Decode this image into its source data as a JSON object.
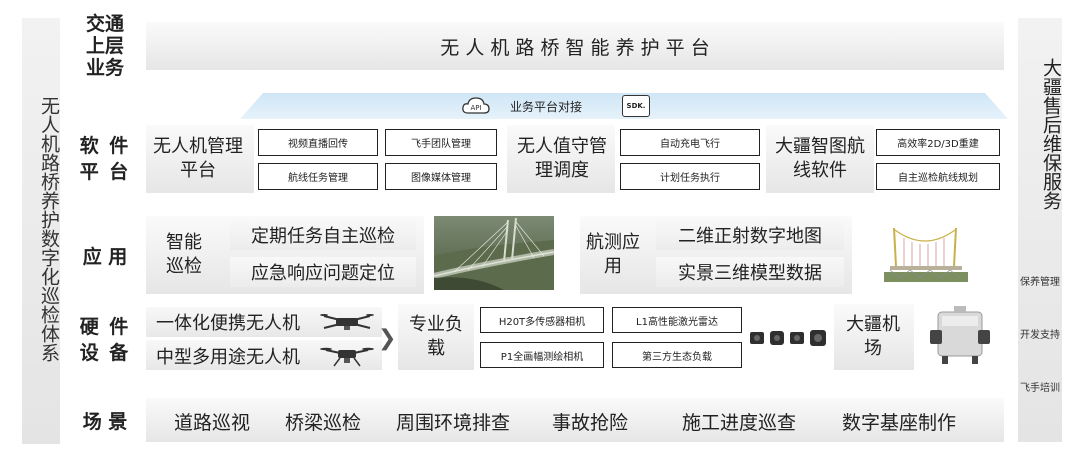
{
  "left_side_title": "无人机路桥养护数字化巡检体系",
  "right_side": {
    "title": "大疆售后维保服务",
    "items": [
      "保养管理",
      "开发支持",
      "飞手培训"
    ]
  },
  "top": {
    "label": "交通上层业务",
    "platform_title": "无 人 机 路 桥 智 能 养 护 平 台"
  },
  "software": {
    "label": "软 件 平 台",
    "connector": {
      "api": "API",
      "text": "业务平台对接",
      "sdk": "SDK."
    },
    "groups": [
      {
        "title": "无人机管理平台",
        "items": [
          "视频直播回传",
          "飞手团队管理",
          "航线任务管理",
          "图像媒体管理"
        ]
      },
      {
        "title": "无人值守管理调度",
        "items": [
          "自动充电飞行",
          "计划任务执行"
        ]
      },
      {
        "title": "大疆智图航线软件",
        "items": [
          "高效率2D/3D重建",
          "自主巡检航线规划"
        ]
      }
    ]
  },
  "application": {
    "label": "应 用",
    "smart_patrol": "智能巡检",
    "patrol_items": [
      "定期任务自主巡检",
      "应急响应问题定位"
    ],
    "survey_label": "航测应用",
    "survey_items": [
      "二维正射数字地图",
      "实景三维模型数据"
    ]
  },
  "hardware": {
    "label": "硬 件 设 备",
    "drones": [
      "一体化便携无人机",
      "中型多用途无人机"
    ],
    "payload_label": "专业负载",
    "payloads": [
      "H20T多传感器相机",
      "L1高性能激光雷达",
      "P1全画幅测绘相机",
      "第三方生态负载"
    ],
    "dock_label": "大疆机场"
  },
  "scenes": {
    "label": "场 景",
    "items": [
      "道路巡视",
      "桥梁巡检",
      "周围环境排查",
      "事故抢险",
      "施工进度巡查",
      "数字基座制作"
    ]
  }
}
